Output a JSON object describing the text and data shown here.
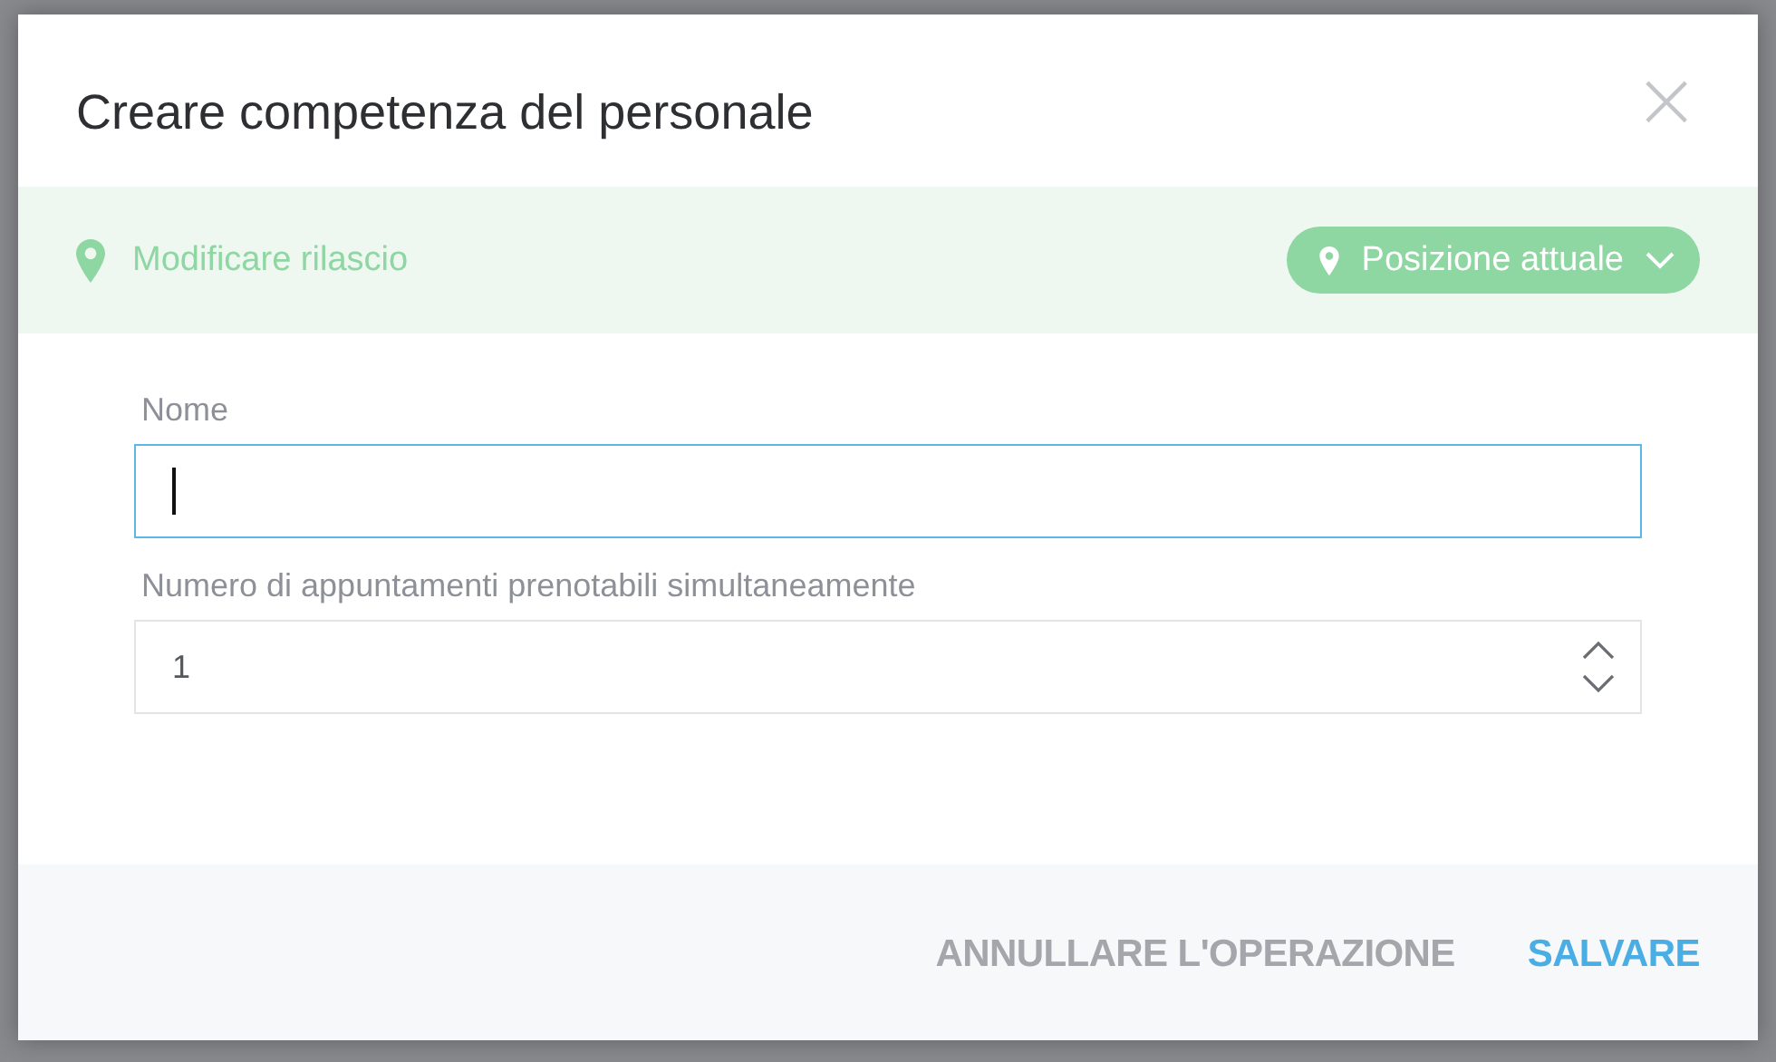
{
  "dialog": {
    "title": "Creare competenza del personale",
    "close": "×"
  },
  "location_bar": {
    "label": "Modificare rilascio",
    "button": "Posizione attuale"
  },
  "fields": [
    {
      "kind": "text",
      "label": "Nome",
      "focused": true
    },
    {
      "kind": "number",
      "label": "Numero di appuntamenti prenotabili simultaneamente",
      "value": "1",
      "focused": false
    }
  ],
  "buttons": [
    {
      "label": "ANNULLARE L'OPERAZIONE",
      "kind": "secondary"
    },
    {
      "label": "SALVARE",
      "kind": "primary"
    }
  ]
}
